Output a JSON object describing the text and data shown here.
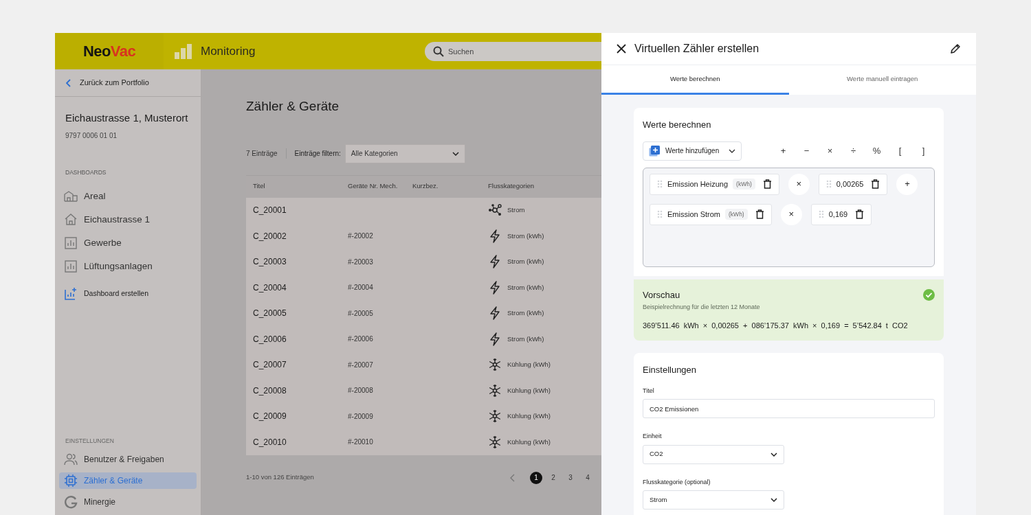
{
  "header": {
    "logo": [
      {
        "text": "Neo",
        "color": "#141414"
      },
      {
        "text": "Vac",
        "color": "#d8321f"
      }
    ],
    "app_title": "Monitoring",
    "search": {
      "placeholder": "Suchen"
    }
  },
  "sidebar": {
    "back": "Zurück zum Portfolio",
    "property": {
      "name": "Eichaustrasse 1, Musterort",
      "number": "9797 0006 01 01"
    },
    "dashboards": {
      "heading": "DASHBOARDS",
      "items": [
        {
          "label": "Areal",
          "kind": "building"
        },
        {
          "label": "Eichaustrasse 1",
          "kind": "house"
        },
        {
          "label": "Gewerbe",
          "kind": "chart"
        },
        {
          "label": "Lüftungsanlagen",
          "kind": "chart"
        }
      ],
      "create": "Dashboard erstellen"
    },
    "settings": {
      "heading": "EINSTELLUNGEN",
      "items": [
        {
          "label": "Benutzer & Freigaben",
          "kind": "users",
          "selected": false
        },
        {
          "label": "Zähler & Geräte",
          "kind": "chip",
          "selected": true
        },
        {
          "label": "Minergie",
          "kind": "g",
          "selected": false
        }
      ]
    }
  },
  "main": {
    "title": "Zähler & Geräte",
    "count": "7 Einträge",
    "filter": {
      "label": "Einträge filtern:",
      "value": "Alle Kategorien"
    },
    "table": {
      "columns": [
        "Titel",
        "Geräte Nr. Mech.",
        "Kurzbez.",
        "Flusskategorien"
      ],
      "rows": [
        {
          "title": "C_20001",
          "device": "",
          "category": {
            "kind": "network",
            "label": "Strom"
          }
        },
        {
          "title": "C_20002",
          "device": "#-20002",
          "category": {
            "kind": "power",
            "label": "Strom (kWh)"
          }
        },
        {
          "title": "C_20003",
          "device": "#-20003",
          "category": {
            "kind": "power",
            "label": "Strom (kWh)"
          }
        },
        {
          "title": "C_20004",
          "device": "#-20004",
          "category": {
            "kind": "power",
            "label": "Strom (kWh)"
          }
        },
        {
          "title": "C_20005",
          "device": "#-20005",
          "category": {
            "kind": "power",
            "label": "Strom (kWh)"
          }
        },
        {
          "title": "C_20006",
          "device": "#-20006",
          "category": {
            "kind": "power",
            "label": "Strom (kWh)"
          }
        },
        {
          "title": "C_20007",
          "device": "#-20007",
          "category": {
            "kind": "cooling",
            "label": "Kühlung (kWh)"
          }
        },
        {
          "title": "C_20008",
          "device": "#-20008",
          "category": {
            "kind": "cooling",
            "label": "Kühlung (kWh)"
          }
        },
        {
          "title": "C_20009",
          "device": "#-20009",
          "category": {
            "kind": "cooling",
            "label": "Kühlung (kWh)"
          }
        },
        {
          "title": "C_20010",
          "device": "#-20010",
          "category": {
            "kind": "cooling",
            "label": "Kühlung (kWh)"
          }
        }
      ]
    },
    "pagination": {
      "summary": "1-10 von 126 Einträgen",
      "pages": [
        {
          "label": "1",
          "selected": true
        },
        {
          "label": "2",
          "selected": false
        },
        {
          "label": "3",
          "selected": false
        },
        {
          "label": "4",
          "selected": false
        }
      ]
    }
  },
  "panel": {
    "title": "Virtuellen Zähler erstellen",
    "tabs": [
      {
        "label": "Werte berechnen",
        "selected": true
      },
      {
        "label": "Werte manuell eintragen",
        "selected": false
      }
    ],
    "calc": {
      "title": "Werte berechnen",
      "add_button": "Werte hinzufügen",
      "operators": [
        "+",
        "−",
        "×",
        "÷",
        "%",
        "[",
        "]"
      ],
      "rows": [
        [
          {
            "kind": "term",
            "label": "Emission Heizung",
            "unit": "(kWh)"
          },
          {
            "kind": "operator",
            "label": "×"
          },
          {
            "kind": "constant",
            "label": "0,00265"
          },
          {
            "kind": "operator",
            "label": "+"
          }
        ],
        [
          {
            "kind": "term",
            "label": "Emission Strom",
            "unit": "(kWh)"
          },
          {
            "kind": "operator",
            "label": "×"
          },
          {
            "kind": "constant",
            "label": "0,169"
          }
        ]
      ]
    },
    "preview": {
      "title": "Vorschau",
      "subtitle": "Beispielrechnung für die letzten 12 Monate",
      "formula": "369’511.46 kWh × 0,00265 + 086’175.37 kWh × 0,169 = 5’542.84 t CO2",
      "valid": true
    },
    "settings": {
      "title": "Einstellungen",
      "fields": [
        {
          "kind": "text",
          "label": "Titel",
          "value": "CO2 Emissionen"
        },
        {
          "kind": "select",
          "label": "Einheit",
          "value": "CO2"
        },
        {
          "kind": "select",
          "label": "Flusskategorie (optional)",
          "value": "Strom"
        }
      ]
    }
  }
}
